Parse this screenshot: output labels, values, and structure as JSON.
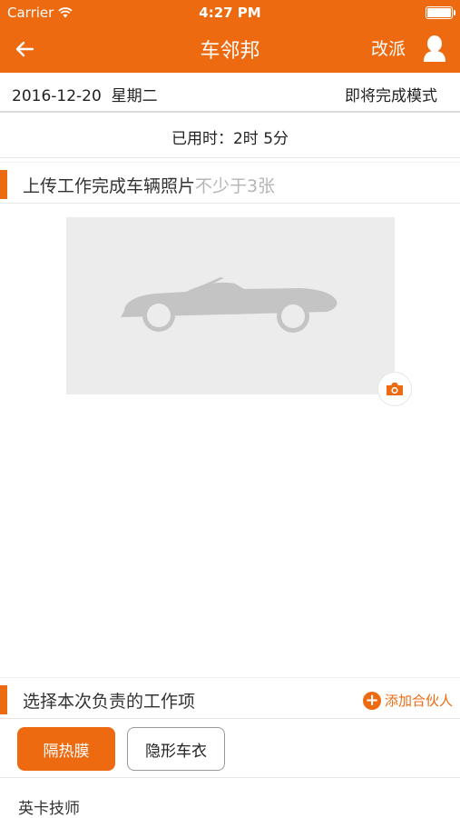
{
  "status_bar": {
    "carrier": "Carrier",
    "time": "4:27 PM"
  },
  "nav": {
    "title": "车邻邦",
    "reassign_label": "改派",
    "back_icon": "arrow-left-icon",
    "user_icon": "user-icon"
  },
  "date_row": {
    "date": "2016-12-20  星期二",
    "mode": "即将完成模式"
  },
  "elapsed": {
    "text": "已用时：2时 5分"
  },
  "upload_section": {
    "title": "上传工作完成车辆照片",
    "hint": "不少于3张",
    "photo_icon": "car-placeholder-icon",
    "camera_icon": "camera-icon"
  },
  "work_section": {
    "title": "选择本次负责的工作项",
    "add_partner_label": "添加合伙人"
  },
  "work_items": [
    {
      "label": "隔热膜",
      "selected": true
    },
    {
      "label": "隐形车衣",
      "selected": false
    }
  ],
  "technician": {
    "text": "英卡技师"
  },
  "colors": {
    "accent": "#ee6a10",
    "photo_bg": "#ececec",
    "placeholder_car": "#c4c4c4"
  }
}
